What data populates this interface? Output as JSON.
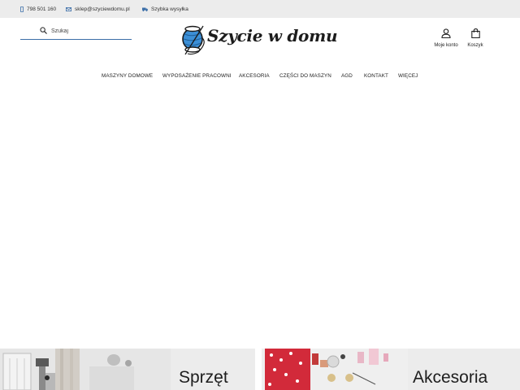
{
  "topbar": {
    "phone": "798 501 160",
    "email": "sklep@szyciewdomu.pl",
    "shipping": "Szybka wysyłka"
  },
  "search": {
    "placeholder": "Szukaj"
  },
  "logo": {
    "text": "Szycie w domu"
  },
  "header": {
    "account_label": "Moje konto",
    "cart_label": "Koszyk"
  },
  "nav": {
    "items": [
      "MASZYNY DOMOWE",
      "WYPOSAŻENIE PRACOWNI",
      "AKCESORIA",
      "CZĘŚCI DO MASZYN",
      "AGD",
      "KONTAKT",
      "WIĘCEJ"
    ]
  },
  "tiles": {
    "left_label": "Sprzęt",
    "right_label": "Akcesoria"
  },
  "colors": {
    "topbar_bg": "#ececec",
    "accent": "#3b6ea8",
    "logo_blue": "#3c8fd6",
    "tile_bg": "#ececec"
  }
}
